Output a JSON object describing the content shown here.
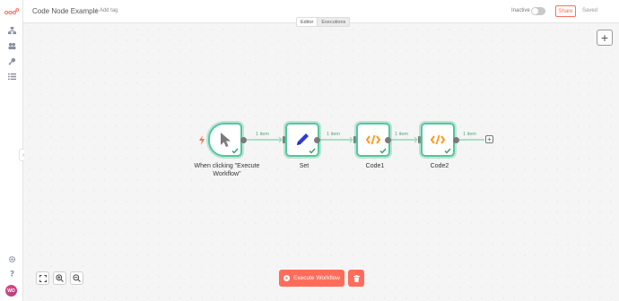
{
  "header": {
    "workflow_name": "Code Node Example",
    "add_tag_label": "+ Add tag",
    "active_label": "Inactive",
    "share_label": "Share",
    "save_status": "Saved"
  },
  "tabs": [
    {
      "label": "Editor",
      "active": true
    },
    {
      "label": "Executions",
      "active": false
    }
  ],
  "sidebar": {
    "items": [
      {
        "icon": "workflows-icon"
      },
      {
        "icon": "templates-icon"
      },
      {
        "icon": "credentials-icon"
      },
      {
        "icon": "executions-icon"
      }
    ],
    "bottom": [
      {
        "icon": "settings-icon"
      },
      {
        "icon": "help-icon"
      }
    ],
    "avatar_initials": "WO"
  },
  "nodes": [
    {
      "name": "When clicking \"Execute Workflow\"",
      "label_line1": "When clicking \"Execute",
      "label_line2": "Workflow\"",
      "icon": "cursor-icon"
    },
    {
      "name": "Set",
      "icon": "pen-icon"
    },
    {
      "name": "Code1",
      "icon": "code-icon"
    },
    {
      "name": "Code2",
      "icon": "code-icon"
    }
  ],
  "edges": [
    {
      "label": "1 item"
    },
    {
      "label": "1 item"
    },
    {
      "label": "1 item"
    },
    {
      "label": "1 item"
    }
  ],
  "footer": {
    "execute_label": "Execute Workflow"
  },
  "colors": {
    "accent": "#ff6d5a",
    "success": "#53c79c",
    "code_orange": "#ff9922",
    "set_blue": "#2d3bdb"
  }
}
